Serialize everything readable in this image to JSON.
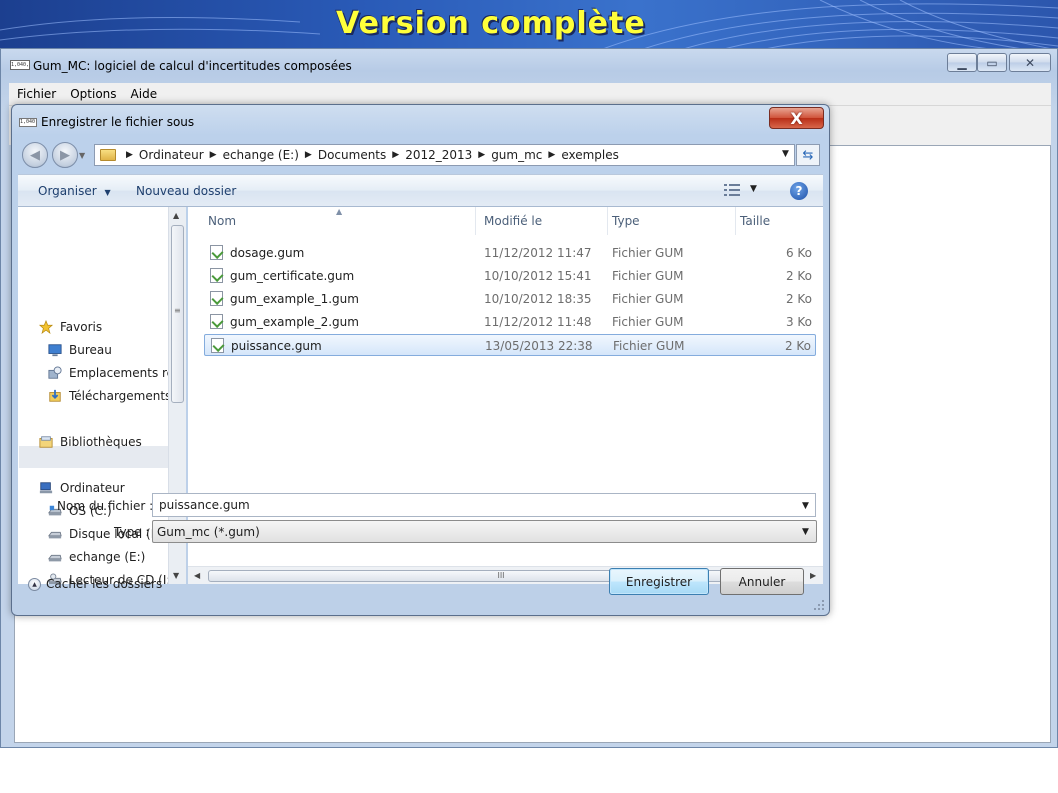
{
  "slide": {
    "title": "Version complète"
  },
  "app": {
    "logo_text": "1,040,1",
    "title": "Gum_MC: logiciel de calcul d'incertitudes composées",
    "menu": [
      {
        "label": "Fichier"
      },
      {
        "label": "Options"
      },
      {
        "label": "Aide"
      }
    ]
  },
  "dialog": {
    "logo_text": "1,040,1",
    "title": "Enregistrer le fichier sous",
    "close_glyph": "X",
    "address": {
      "crumbs": [
        "Ordinateur",
        "echange (E:)",
        "Documents",
        "2012_2013",
        "gum_mc",
        "exemples"
      ]
    },
    "toolbar": {
      "organize_label": "Organiser",
      "new_folder_label": "Nouveau dossier",
      "help_glyph": "?"
    },
    "nav": {
      "items": [
        {
          "label": "Favoris",
          "icon": "star-icon",
          "indent": 0
        },
        {
          "label": "Bureau",
          "icon": "desktop-icon",
          "indent": 1
        },
        {
          "label": "Emplacements ré",
          "icon": "recent-places-icon",
          "indent": 1
        },
        {
          "label": "Téléchargements",
          "icon": "downloads-icon",
          "indent": 1
        },
        {
          "label": "Bibliothèques",
          "icon": "libraries-icon",
          "indent": 0
        },
        {
          "label": "Ordinateur",
          "icon": "computer-icon",
          "indent": 0
        },
        {
          "label": "OS (C:)",
          "icon": "drive-icon",
          "indent": 1
        },
        {
          "label": "Disque local (D:)",
          "icon": "drive-icon",
          "indent": 1
        },
        {
          "label": "echange (E:)",
          "icon": "drive-icon",
          "indent": 1
        },
        {
          "label": "Lecteur de CD (I:)",
          "icon": "cd-drive-icon",
          "indent": 1
        }
      ],
      "selected_index": 8
    },
    "columns": {
      "name": "Nom",
      "modified": "Modifié le",
      "type": "Type",
      "size": "Taille"
    },
    "files": [
      {
        "name": "dosage.gum",
        "modified": "11/12/2012 11:47",
        "type": "Fichier GUM",
        "size": "6 Ko"
      },
      {
        "name": "gum_certificate.gum",
        "modified": "10/10/2012 15:41",
        "type": "Fichier GUM",
        "size": "2 Ko"
      },
      {
        "name": "gum_example_1.gum",
        "modified": "10/10/2012 18:35",
        "type": "Fichier GUM",
        "size": "2 Ko"
      },
      {
        "name": "gum_example_2.gum",
        "modified": "11/12/2012 11:48",
        "type": "Fichier GUM",
        "size": "3 Ko"
      },
      {
        "name": "puissance.gum",
        "modified": "13/05/2013 22:38",
        "type": "Fichier GUM",
        "size": "2 Ko"
      }
    ],
    "selected_file_index": 4,
    "hscroll_grip": "III",
    "filename_label": "Nom du fichier :",
    "filename_value": "puissance.gum",
    "type_label": "Type :",
    "type_value": "Gum_mc (*.gum)",
    "hide_folders_label": "Cacher les dossiers",
    "save_label": "Enregistrer",
    "cancel_label": "Annuler"
  },
  "colors": {
    "banner_blue": "#2a5bb8",
    "banner_title": "#ffff3a",
    "selection_border": "#84acdd",
    "save_button_border": "#3c7fb1"
  }
}
